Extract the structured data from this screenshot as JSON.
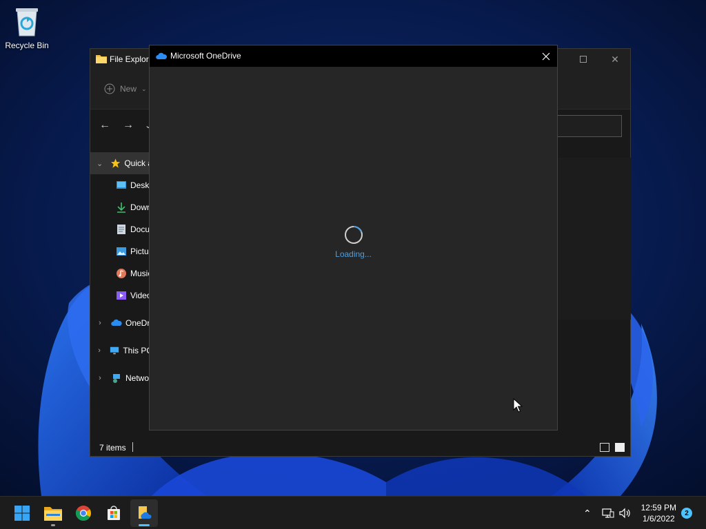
{
  "desktop": {
    "icons": [
      {
        "label": "Recycle Bin",
        "icon": "recycle-bin-icon"
      }
    ]
  },
  "explorer": {
    "title": "File Explore",
    "toolbar": {
      "new_label": "New"
    },
    "sidebar": [
      {
        "label": "Quick a",
        "icon": "star-icon",
        "expand": "expanded",
        "selected": true
      },
      {
        "label": "Deskt",
        "icon": "desktop-folder-icon"
      },
      {
        "label": "Down",
        "icon": "download-icon"
      },
      {
        "label": "Docu",
        "icon": "document-icon"
      },
      {
        "label": "Pictu",
        "icon": "pictures-icon"
      },
      {
        "label": "Music",
        "icon": "music-icon"
      },
      {
        "label": "Video",
        "icon": "videos-icon"
      },
      {
        "label": "OneDri",
        "icon": "onedrive-cloud-icon",
        "expand": "collapsed"
      },
      {
        "label": "This PC",
        "icon": "this-pc-icon",
        "expand": "collapsed"
      },
      {
        "label": "Netwo",
        "icon": "network-icon",
        "expand": "collapsed"
      }
    ],
    "status": {
      "items": "7 items"
    }
  },
  "onedrive": {
    "title": "Microsoft OneDrive",
    "loading_text": "Loading..."
  },
  "taskbar": {
    "apps": [
      {
        "name": "start",
        "icon": "windows-start-icon"
      },
      {
        "name": "file-explorer",
        "icon": "file-explorer-icon",
        "running": true
      },
      {
        "name": "chrome",
        "icon": "chrome-icon"
      },
      {
        "name": "store",
        "icon": "microsoft-store-icon"
      },
      {
        "name": "onedrive-setup",
        "icon": "onedrive-setup-icon",
        "active": true
      }
    ],
    "clock": {
      "time": "12:59 PM",
      "date": "1/6/2022"
    },
    "notifications": "2"
  },
  "colors": {
    "accent": "#4cc2ff",
    "loading_text": "#4f9fe0",
    "window_bg": "#262626",
    "taskbar_bg": "#1c1c1c"
  }
}
